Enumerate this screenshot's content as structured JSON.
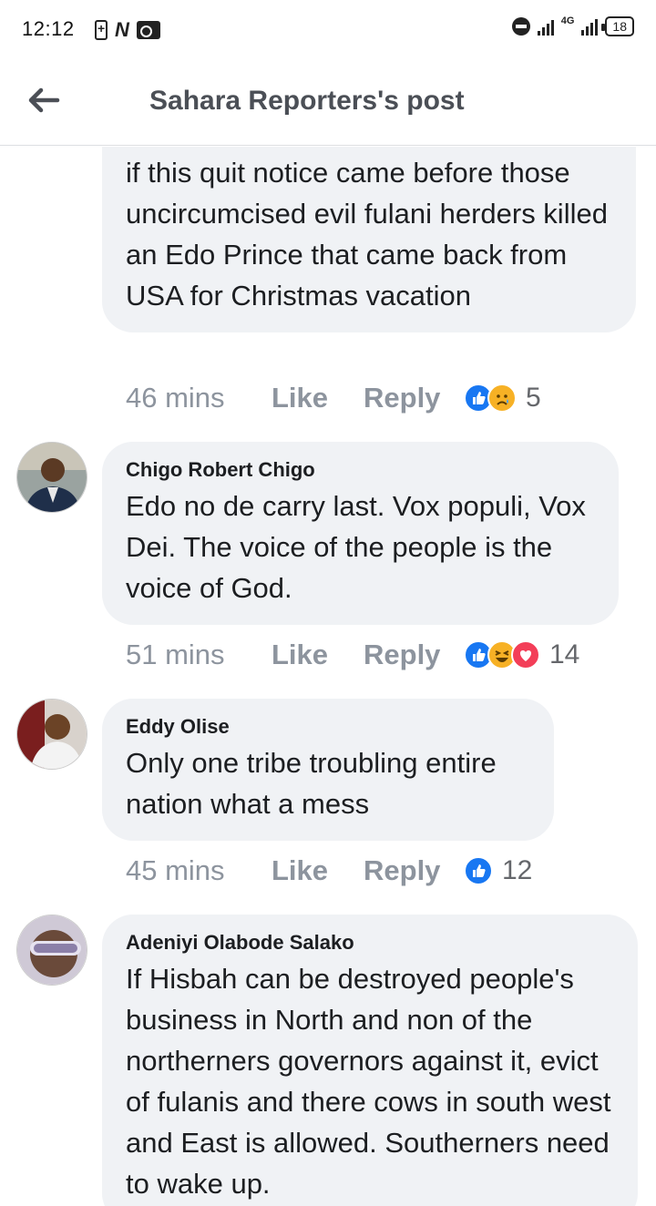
{
  "status_bar": {
    "time": "12:12",
    "network": "4G",
    "battery": "18"
  },
  "header": {
    "title": "Sahara Reporters's post"
  },
  "comments": [
    {
      "author": "",
      "text": "if this quit notice came before those uncircumcised evil fulani herders killed an Edo Prince that came back from USA for Christmas vacation",
      "time": "46 mins",
      "like_label": "Like",
      "reply_label": "Reply",
      "reactions": [
        "like",
        "sad"
      ],
      "reaction_count": "5"
    },
    {
      "author": "Chigo Robert Chigo",
      "text": "Edo no de carry last. Vox populi, Vox Dei. The voice of the people is the voice of God.",
      "time": "51 mins",
      "like_label": "Like",
      "reply_label": "Reply",
      "reactions": [
        "like",
        "haha",
        "love"
      ],
      "reaction_count": "14"
    },
    {
      "author": "Eddy Olise",
      "text": "Only one tribe troubling entire nation what a mess",
      "time": "45 mins",
      "like_label": "Like",
      "reply_label": "Reply",
      "reactions": [
        "like"
      ],
      "reaction_count": "12"
    },
    {
      "author": "Adeniyi Olabode Salako",
      "text": "If Hisbah can be destroyed people's business in North and non of the northerners governors against it, evict of fulanis and there cows in south west and East is allowed. Southerners need to wake up.",
      "time": "",
      "like_label": "",
      "reply_label": "",
      "reactions": [],
      "reaction_count": ""
    }
  ],
  "colors": {
    "bubble_bg": "#f0f2f5",
    "meta_text": "#8d949e",
    "like_blue": "#1877f2",
    "reaction_yellow": "#f7b125",
    "reaction_love": "#f33e58"
  }
}
